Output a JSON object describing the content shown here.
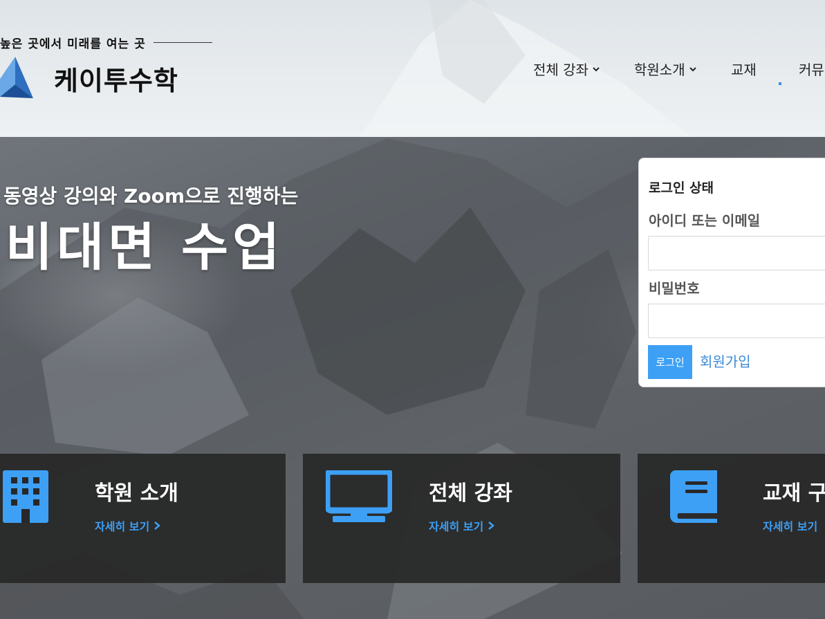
{
  "header": {
    "slogan": "높은 곳에서 미래를 여는 곳",
    "brand": "케이투수학",
    "nav": [
      {
        "label": "전체 강좌",
        "has_dropdown": true
      },
      {
        "label": "학원소개",
        "has_dropdown": true
      },
      {
        "label": "교재",
        "has_dropdown": false
      },
      {
        "label": "커뮤",
        "has_dropdown": false
      }
    ]
  },
  "hero": {
    "subtitle": "동영상 강의와 Zoom으로 진행하는",
    "title": "비대면 수업"
  },
  "login": {
    "title": "로그인 상태",
    "id_label": "아이디 또는 이메일",
    "id_value": "",
    "password_label": "비밀번호",
    "password_value": "",
    "submit_label": "로그인",
    "signup_label": "회원가입"
  },
  "features": [
    {
      "title": "학원 소개",
      "link": "자세히 보기",
      "icon": "building-icon"
    },
    {
      "title": "전체 강좌",
      "link": "자세히 보기",
      "icon": "monitor-icon"
    },
    {
      "title": "교재 구",
      "link": "자세히 보기",
      "icon": "book-icon"
    }
  ],
  "colors": {
    "accent": "#3da0f5",
    "link": "#3a8ad8",
    "feature_bg": "#282828"
  }
}
